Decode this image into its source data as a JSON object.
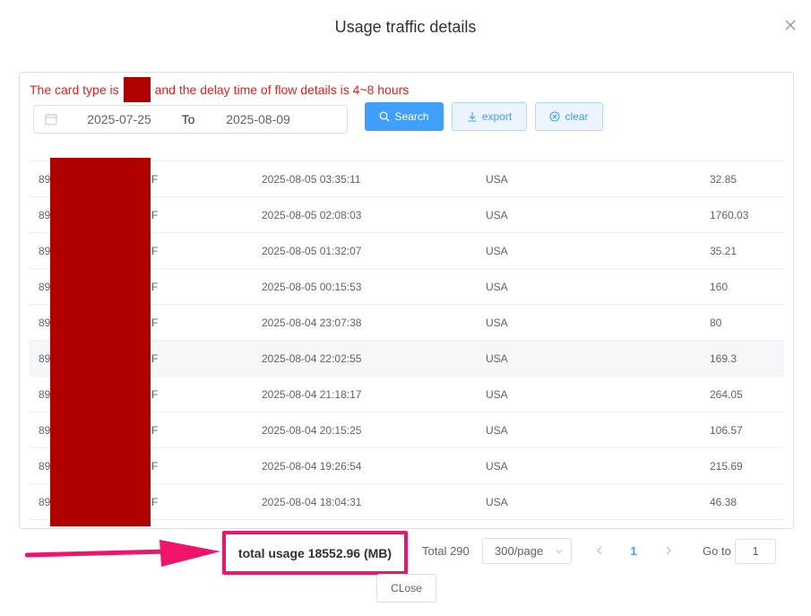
{
  "dialog": {
    "title": "Usage traffic details"
  },
  "notice": {
    "before": "The card type is",
    "after": "and the delay time of flow details is 4~8 hours"
  },
  "filter": {
    "start_date": "2025-07-25",
    "separator": "To",
    "end_date": "2025-08-09"
  },
  "toolbar": {
    "search_label": "Search",
    "export_label": "export",
    "clear_label": "clear"
  },
  "table": {
    "rows": [
      {
        "id": "89",
        "suffix": "F",
        "time": "2025-08-05 03:35:11",
        "country": "USA",
        "usage": "32.85"
      },
      {
        "id": "89",
        "suffix": "F",
        "time": "2025-08-05 02:08:03",
        "country": "USA",
        "usage": "1760.03"
      },
      {
        "id": "89",
        "suffix": "F",
        "time": "2025-08-05 01:32:07",
        "country": "USA",
        "usage": "35.21"
      },
      {
        "id": "89",
        "suffix": "F",
        "time": "2025-08-05 00:15:53",
        "country": "USA",
        "usage": "160"
      },
      {
        "id": "89",
        "suffix": "F",
        "time": "2025-08-04 23:07:38",
        "country": "USA",
        "usage": "80"
      },
      {
        "id": "89",
        "suffix": "F",
        "time": "2025-08-04 22:02:55",
        "country": "USA",
        "usage": "169.3"
      },
      {
        "id": "89",
        "suffix": "F",
        "time": "2025-08-04 21:18:17",
        "country": "USA",
        "usage": "264.05"
      },
      {
        "id": "89",
        "suffix": "F",
        "time": "2025-08-04 20:15:25",
        "country": "USA",
        "usage": "106.57"
      },
      {
        "id": "89",
        "suffix": "F",
        "time": "2025-08-04 19:26:54",
        "country": "USA",
        "usage": "215.69"
      },
      {
        "id": "89",
        "suffix": "F",
        "time": "2025-08-04 18:04:31",
        "country": "USA",
        "usage": "46.38"
      }
    ],
    "highlighted_row": 5
  },
  "footer": {
    "total_usage": "total usage 18552.96 (MB)",
    "total_count": "Total 290",
    "page_size": "300/page",
    "current_page": "1",
    "goto_label": "Go to",
    "goto_value": "1",
    "close_label": "CLose"
  },
  "colors": {
    "primary": "#409eff",
    "notice_red": "#e0201b",
    "redaction": "#b00000",
    "annotation_pink": "#f0136a"
  },
  "icons": {
    "close": "close-icon",
    "calendar": "calendar-icon",
    "search": "search-icon",
    "export": "download-icon",
    "clear": "clear-circle-icon",
    "prev": "chevron-left-icon",
    "next": "chevron-right-icon",
    "dropdown": "chevron-down-icon",
    "annotation": "arrow-right-icon"
  }
}
